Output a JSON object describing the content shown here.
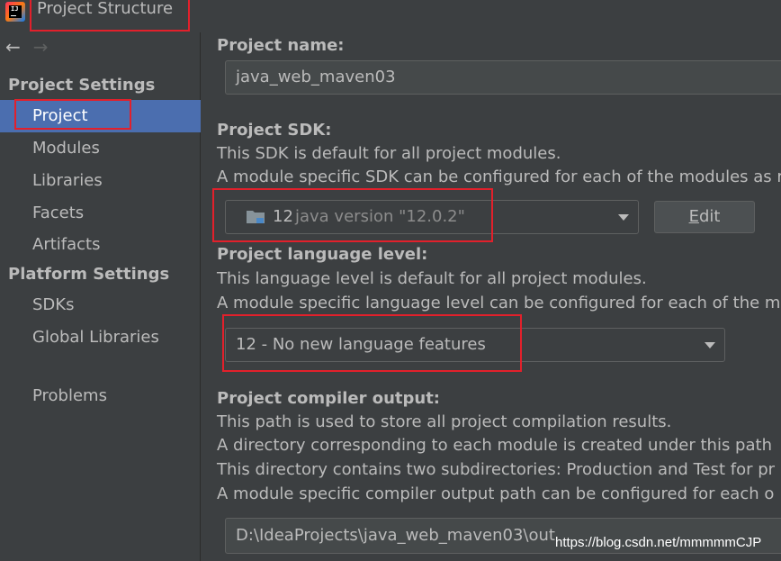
{
  "window": {
    "title": "Project Structure",
    "app_icon": "intellij-idea-icon"
  },
  "nav": {
    "back_icon": "arrow-left-icon",
    "forward_icon": "arrow-right-icon"
  },
  "sidebar": {
    "project_settings_header": "Project Settings",
    "project_settings_items": [
      {
        "label": "Project",
        "selected": true
      },
      {
        "label": "Modules"
      },
      {
        "label": "Libraries"
      },
      {
        "label": "Facets"
      },
      {
        "label": "Artifacts"
      }
    ],
    "platform_settings_header": "Platform Settings",
    "platform_settings_items": [
      {
        "label": "SDKs"
      },
      {
        "label": "Global Libraries"
      }
    ],
    "problems_label": "Problems"
  },
  "main": {
    "project_name": {
      "label": "Project name:",
      "value": "java_web_maven03"
    },
    "project_sdk": {
      "label": "Project SDK:",
      "desc1": "This SDK is default for all project modules.",
      "desc2": "A module specific SDK can be configured for each of the modules as r",
      "selected_version": "12",
      "selected_detail": "java version \"12.0.2\"",
      "edit_label_mnemonic": "E",
      "edit_label_rest": "dit"
    },
    "language_level": {
      "label": "Project language level:",
      "desc1": "This language level is default for all project modules.",
      "desc2": "A module specific language level can be configured for each of the m",
      "selected": "12 - No new language features"
    },
    "compiler_output": {
      "label": "Project compiler output:",
      "desc1": "This path is used to store all project compilation results.",
      "desc2": "A directory corresponding to each module is created under this path",
      "desc3": "This directory contains two subdirectories: Production and Test for pr",
      "desc4": "A module specific compiler output path can be configured for each o",
      "value": "D:\\IdeaProjects\\java_web_maven03\\out"
    }
  },
  "watermark": "https://blog.csdn.net/mmmmmCJP",
  "colors": {
    "highlight_box": "#e2202b",
    "selection": "#4b6eaf",
    "background": "#3c3f41"
  }
}
